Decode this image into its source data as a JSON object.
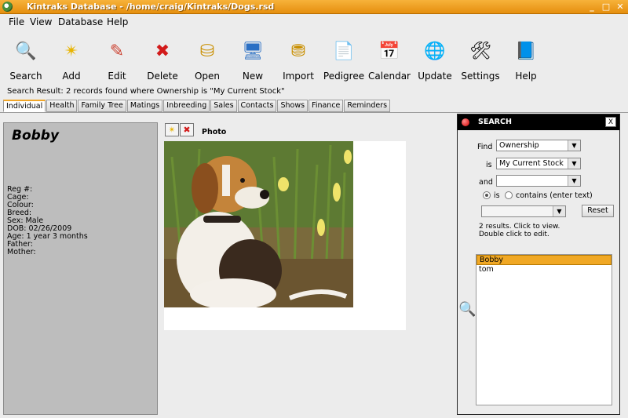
{
  "window": {
    "title": "Kintraks Database - /home/craig/Kintraks/Dogs.rsd",
    "controls": [
      "_",
      "□",
      "✕"
    ]
  },
  "menu": [
    {
      "label": "File"
    },
    {
      "label": "View"
    },
    {
      "label": "Database"
    },
    {
      "label": "Help"
    }
  ],
  "toolbar": [
    {
      "label": "Search",
      "icon": "magnifier-icon",
      "glyph": "🔍"
    },
    {
      "label": "Add",
      "icon": "sparkle-icon",
      "glyph": "✴"
    },
    {
      "label": "Edit",
      "icon": "pencil-icon",
      "glyph": "✎"
    },
    {
      "label": "Delete",
      "icon": "red-x-icon",
      "glyph": "✖"
    },
    {
      "label": "Open",
      "icon": "coins-icon",
      "glyph": "⛁"
    },
    {
      "label": "New",
      "icon": "computer-icon",
      "glyph": "🖥"
    },
    {
      "label": "Import",
      "icon": "import-coins-icon",
      "glyph": "⛃"
    },
    {
      "label": "Pedigree",
      "icon": "document-icon",
      "glyph": "📄"
    },
    {
      "label": "Calendar",
      "icon": "calendar-icon",
      "glyph": "📅"
    },
    {
      "label": "Update",
      "icon": "globe-icon",
      "glyph": "🌐"
    },
    {
      "label": "Settings",
      "icon": "tools-icon",
      "glyph": "🛠"
    },
    {
      "label": "Help",
      "icon": "help-book-icon",
      "glyph": "📘"
    }
  ],
  "status": {
    "text": "Search Result: 2 records found where Ownership is \"My Current Stock\""
  },
  "tabs": [
    {
      "label": "Individual",
      "active": true
    },
    {
      "label": "Health"
    },
    {
      "label": "Family Tree"
    },
    {
      "label": "Matings"
    },
    {
      "label": "Inbreeding"
    },
    {
      "label": "Sales"
    },
    {
      "label": "Contacts"
    },
    {
      "label": "Shows"
    },
    {
      "label": "Finance"
    },
    {
      "label": "Reminders"
    }
  ],
  "record": {
    "name": "Bobby",
    "fields": [
      {
        "text": "Reg #:"
      },
      {
        "text": "Cage:"
      },
      {
        "text": "Colour:"
      },
      {
        "text": "Breed:"
      },
      {
        "text": "Sex: Male"
      },
      {
        "text": "DOB:  02/26/2009"
      },
      {
        "text": "Age: 1 year 3 months"
      },
      {
        "text": "Father:"
      },
      {
        "text": "Mother:"
      }
    ]
  },
  "photo": {
    "label": "Photo",
    "add_glyph": "✴",
    "delete_glyph": "✖"
  },
  "search": {
    "title": "SEARCH",
    "close": "X",
    "find_label": "Find",
    "find_value": "Ownership",
    "is_label": "is",
    "is_value": "My Current Stock",
    "and_label": "and",
    "and_value": "",
    "radio_is": "is",
    "radio_contains": "contains (enter text)",
    "extra_value": "",
    "reset": "Reset",
    "hint_line1": "2 results. Click to view.",
    "hint_line2": "Double click to edit.",
    "results": [
      {
        "text": "Bobby",
        "selected": true
      },
      {
        "text": "tom"
      }
    ],
    "magnifier_glyph": "🔍"
  },
  "colors": {
    "accent": "#f0a825",
    "title_bar": "#e58f0e",
    "panel_gray": "#bdbdbd"
  }
}
